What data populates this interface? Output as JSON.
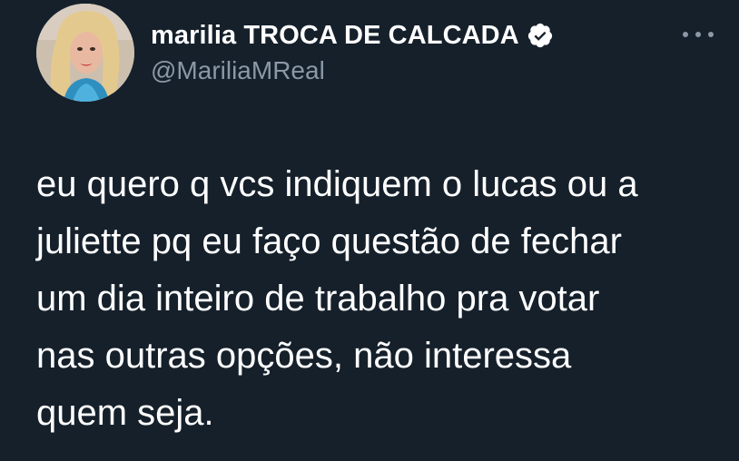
{
  "author": {
    "display_name": "marilia TROCA DE CALCADA",
    "handle": "@MariliaMReal",
    "verified_icon": "verified-badge-icon",
    "avatar": "profile-photo"
  },
  "tweet": {
    "text": "eu quero q vcs indiquem o lucas ou a\njuliette pq eu faço questão de fechar\num dia inteiro de trabalho pra votar\nnas outras opções, não interessa\nquem seja."
  },
  "menu": {
    "icon": "more-options-icon"
  },
  "colors": {
    "background": "#15202b",
    "primary_text": "#ffffff",
    "secondary_text": "#8b98a5"
  }
}
